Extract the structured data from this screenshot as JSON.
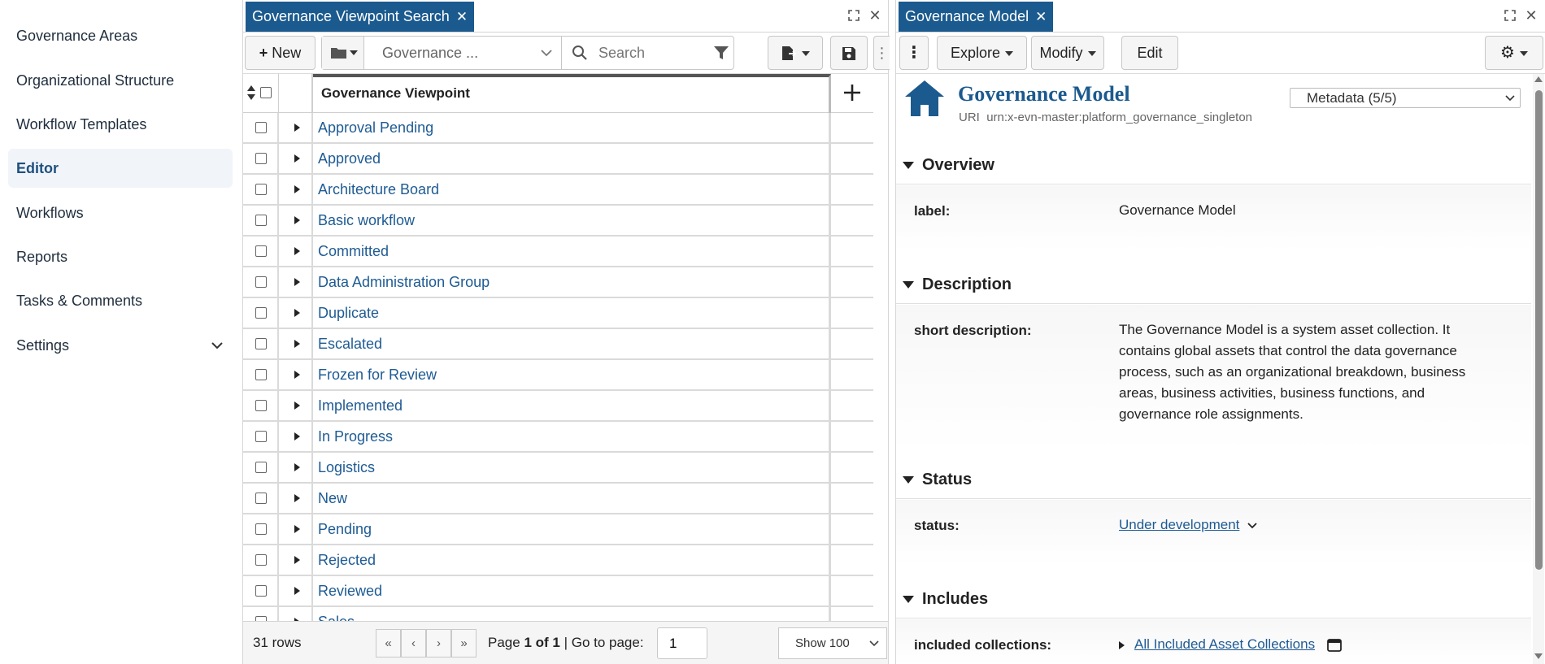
{
  "sidebar": {
    "items": [
      {
        "label": "Governance Areas"
      },
      {
        "label": "Organizational Structure"
      },
      {
        "label": "Workflow Templates"
      },
      {
        "label": "Editor"
      },
      {
        "label": "Workflows"
      },
      {
        "label": "Reports"
      },
      {
        "label": "Tasks & Comments"
      },
      {
        "label": "Settings"
      }
    ],
    "active": "Editor"
  },
  "search_panel": {
    "tab_title": "Governance Viewpoint Search",
    "new_label": "New",
    "asset_type_value": "Governance ...",
    "search_placeholder": "Search",
    "column_header": "Governance Viewpoint",
    "rows": [
      "Approval Pending",
      "Approved",
      "Architecture Board",
      "Basic workflow",
      "Committed",
      "Data Administration Group",
      "Duplicate",
      "Escalated",
      "Frozen for Review",
      "Implemented",
      "In Progress",
      "Logistics",
      "New",
      "Pending",
      "Rejected",
      "Reviewed",
      "Sales"
    ],
    "footer": {
      "row_count": "31 rows",
      "page_prefix": "Page",
      "page_current": "1 of 1",
      "goto_label": "| Go to page:",
      "goto_value": "1",
      "show_value": "Show 100"
    }
  },
  "details_panel": {
    "tab_title": "Governance Model",
    "explore_label": "Explore",
    "modify_label": "Modify",
    "edit_label": "Edit",
    "title": "Governance Model",
    "uri_label": "URI",
    "uri_value": "urn:x-evn-master:platform_governance_singleton",
    "metadata_select": "Metadata (5/5)",
    "sections": {
      "overview": "Overview",
      "description": "Description",
      "status": "Status",
      "includes": "Includes"
    },
    "props": {
      "label_key": "label:",
      "label_val": "Governance Model",
      "short_desc_key": "short description:",
      "short_desc_lines": [
        "The Governance Model is a system asset collection. It",
        "contains global assets that control the data governance",
        "process, such as an organizational breakdown, business",
        "areas, business activities, business functions, and",
        "governance role assignments."
      ],
      "status_key": "status:",
      "status_val": "Under development",
      "included_key": "included collections:",
      "included_val": "All Included Asset Collections"
    }
  },
  "colors": {
    "accent": "#1b5a8e",
    "link": "#1e5b93",
    "active_nav_bg": "#f1f4f8"
  }
}
